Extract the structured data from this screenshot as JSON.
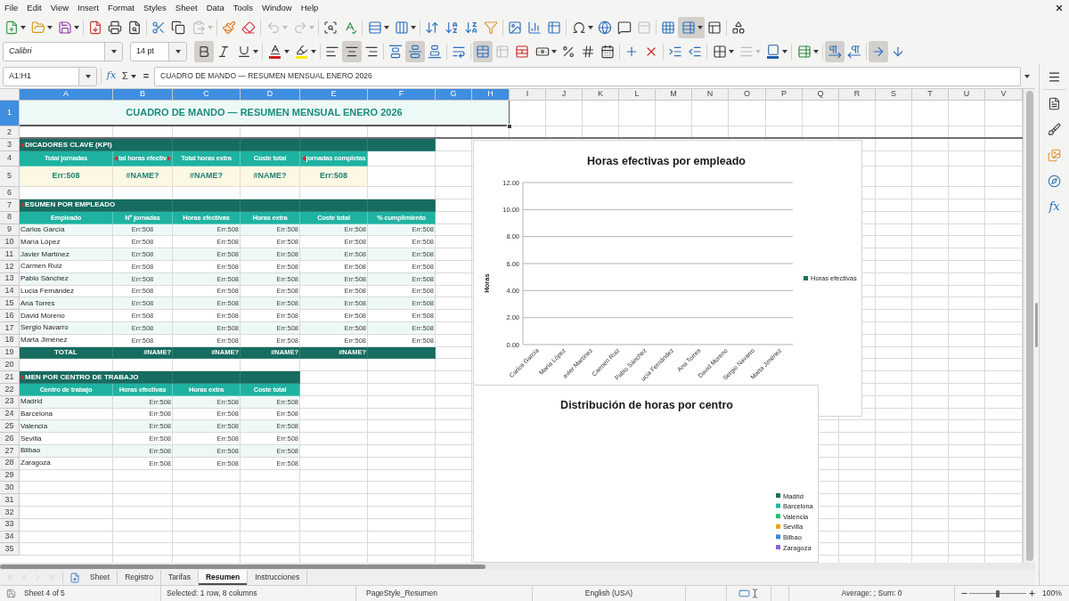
{
  "menu_bar": [
    "File",
    "Edit",
    "View",
    "Insert",
    "Format",
    "Styles",
    "Sheet",
    "Data",
    "Tools",
    "Window",
    "Help"
  ],
  "standard_toolbar": {
    "paste": {
      "disabled": true
    },
    "undo": {
      "disabled": true
    },
    "redo": {
      "disabled": true
    },
    "headers_footers": {
      "disabled": true
    },
    "freeze_rows_columns": {
      "on": true
    }
  },
  "formatting_toolbar": {
    "font_name": "Calibri",
    "font_size": "14 pt",
    "bold": {
      "on": true
    },
    "italic": {
      "on": false
    },
    "underline": {
      "on": false
    },
    "align_left": {
      "on": false
    },
    "align_center": {
      "on": true
    },
    "align_right": {
      "on": false
    },
    "align_top": {
      "on": false
    },
    "align_middle": {
      "on": true
    },
    "align_bottom": {
      "on": false
    },
    "wrap_text": {
      "on": false
    },
    "merge_and_center": {
      "on": true
    },
    "merge_cells": {
      "disabled": true
    },
    "border_style": {
      "disabled": true
    },
    "left_to_right": {
      "on": true
    },
    "right_to_left": {
      "on": false
    },
    "text_horizontal": {
      "on": true
    },
    "text_vertical": {
      "on": false
    }
  },
  "formula_bar": {
    "name_box": "A1:H1",
    "function_wizard": "fx",
    "sum": "Σ",
    "equals": "=",
    "content": "CUADRO DE MANDO — RESUMEN MENSUAL ENERO 2026"
  },
  "sheet": {
    "columns": [
      {
        "label": "A",
        "selected": true
      },
      {
        "label": "B",
        "selected": true
      },
      {
        "label": "C",
        "selected": true
      },
      {
        "label": "D",
        "selected": true
      },
      {
        "label": "E",
        "selected": true
      },
      {
        "label": "F",
        "selected": true
      },
      {
        "label": "G",
        "selected": true
      },
      {
        "label": "H",
        "selected": true
      },
      {
        "label": "I",
        "selected": false
      },
      {
        "label": "J",
        "selected": false
      },
      {
        "label": "K",
        "selected": false
      },
      {
        "label": "L",
        "selected": false
      },
      {
        "label": "M",
        "selected": false
      },
      {
        "label": "N",
        "selected": false
      },
      {
        "label": "O",
        "selected": false
      },
      {
        "label": "P",
        "selected": false
      },
      {
        "label": "Q",
        "selected": false
      },
      {
        "label": "R",
        "selected": false
      },
      {
        "label": "S",
        "selected": false
      },
      {
        "label": "T",
        "selected": false
      },
      {
        "label": "U",
        "selected": false
      },
      {
        "label": "V",
        "selected": false
      }
    ],
    "rows": [
      {
        "label": "1",
        "selected": true
      },
      {
        "label": "2",
        "selected": false
      },
      {
        "label": "3",
        "selected": false
      },
      {
        "label": "4",
        "selected": false
      },
      {
        "label": "5",
        "selected": false
      },
      {
        "label": "6",
        "selected": false
      },
      {
        "label": "7",
        "selected": false
      },
      {
        "label": "8",
        "selected": false
      },
      {
        "label": "9",
        "selected": false
      },
      {
        "label": "10",
        "selected": false
      },
      {
        "label": "11",
        "selected": false
      },
      {
        "label": "12",
        "selected": false
      },
      {
        "label": "13",
        "selected": false
      },
      {
        "label": "14",
        "selected": false
      },
      {
        "label": "15",
        "selected": false
      },
      {
        "label": "16",
        "selected": false
      },
      {
        "label": "17",
        "selected": false
      },
      {
        "label": "18",
        "selected": false
      },
      {
        "label": "19",
        "selected": false
      },
      {
        "label": "20",
        "selected": false
      },
      {
        "label": "21",
        "selected": false
      },
      {
        "label": "22",
        "selected": false
      },
      {
        "label": "23",
        "selected": false
      },
      {
        "label": "24",
        "selected": false
      },
      {
        "label": "25",
        "selected": false
      },
      {
        "label": "26",
        "selected": false
      },
      {
        "label": "27",
        "selected": false
      },
      {
        "label": "28",
        "selected": false
      },
      {
        "label": "29",
        "selected": false
      },
      {
        "label": "30",
        "selected": false
      },
      {
        "label": "31",
        "selected": false
      },
      {
        "label": "32",
        "selected": false
      },
      {
        "label": "33",
        "selected": false
      },
      {
        "label": "34",
        "selected": false
      },
      {
        "label": "35",
        "selected": false
      }
    ],
    "title": "CUADRO DE MANDO — RESUMEN MENSUAL ENERO 2026",
    "kpi": {
      "section": {
        "text": "DICADORES CLAVE (KPI)",
        "clipped_left": true,
        "clipped_right": false
      },
      "headers": [
        {
          "text": "Total jornadas",
          "clipped_left": false,
          "clipped_right": false
        },
        {
          "text": "tal horas efectiv",
          "clipped_left": true,
          "clipped_right": true
        },
        {
          "text": "Total horas extra",
          "clipped_left": false,
          "clipped_right": false
        },
        {
          "text": "Coste total",
          "clipped_left": false,
          "clipped_right": false
        },
        {
          "text": "jornadas completas",
          "clipped_left": true,
          "clipped_right": false
        }
      ],
      "values": [
        "Err:508",
        "#NAME?",
        "#NAME?",
        "#NAME?",
        "Err:508"
      ]
    },
    "employees": {
      "section": {
        "text": "ESUMEN POR EMPLEADO",
        "clipped_left": true,
        "clipped_right": false
      },
      "headers": [
        "Empleado",
        "Nº jornadas",
        "Horas efectivas",
        "Horas extra",
        "Coste total",
        "% cumplimiento"
      ],
      "rows": [
        {
          "name": "Carlos García",
          "values": [
            "Err:508",
            "Err:508",
            "Err:508",
            "Err:508",
            "Err:508"
          ]
        },
        {
          "name": "María López",
          "values": [
            "Err:508",
            "Err:508",
            "Err:508",
            "Err:508",
            "Err:508"
          ]
        },
        {
          "name": "Javier Martínez",
          "values": [
            "Err:508",
            "Err:508",
            "Err:508",
            "Err:508",
            "Err:508"
          ]
        },
        {
          "name": "Carmen Ruiz",
          "values": [
            "Err:508",
            "Err:508",
            "Err:508",
            "Err:508",
            "Err:508"
          ]
        },
        {
          "name": "Pablo Sánchez",
          "values": [
            "Err:508",
            "Err:508",
            "Err:508",
            "Err:508",
            "Err:508"
          ]
        },
        {
          "name": "Lucía Fernández",
          "values": [
            "Err:508",
            "Err:508",
            "Err:508",
            "Err:508",
            "Err:508"
          ]
        },
        {
          "name": "Ana Torres",
          "values": [
            "Err:508",
            "Err:508",
            "Err:508",
            "Err:508",
            "Err:508"
          ]
        },
        {
          "name": "David Moreno",
          "values": [
            "Err:508",
            "Err:508",
            "Err:508",
            "Err:508",
            "Err:508"
          ]
        },
        {
          "name": "Sergio Navarro",
          "values": [
            "Err:508",
            "Err:508",
            "Err:508",
            "Err:508",
            "Err:508"
          ]
        },
        {
          "name": "Marta Jiménez",
          "values": [
            "Err:508",
            "Err:508",
            "Err:508",
            "Err:508",
            "Err:508"
          ]
        }
      ],
      "total": {
        "label": "TOTAL",
        "values": [
          "#NAME?",
          "#NAME?",
          "#NAME?",
          "#NAME?"
        ]
      }
    },
    "centers": {
      "section": {
        "text": "MEN POR CENTRO DE TRABAJO",
        "clipped_left": true,
        "clipped_right": false
      },
      "headers": [
        "Centro de trabajo",
        "Horas efectivas",
        "Horas extra",
        "Coste total"
      ],
      "rows": [
        {
          "name": "Madrid",
          "values": [
            "Err:508",
            "Err:508",
            "Err:508"
          ]
        },
        {
          "name": "Barcelona",
          "values": [
            "Err:508",
            "Err:508",
            "Err:508"
          ]
        },
        {
          "name": "Valencia",
          "values": [
            "Err:508",
            "Err:508",
            "Err:508"
          ]
        },
        {
          "name": "Sevilla",
          "values": [
            "Err:508",
            "Err:508",
            "Err:508"
          ]
        },
        {
          "name": "Bilbao",
          "values": [
            "Err:508",
            "Err:508",
            "Err:508"
          ]
        },
        {
          "name": "Zaragoza",
          "values": [
            "Err:508",
            "Err:508",
            "Err:508"
          ]
        }
      ]
    }
  },
  "charts": [
    {
      "kind": "bar",
      "title": "Horas efectivas por empleado",
      "y_axis_title": "Horas",
      "y_ticks": [
        "12.00",
        "10.00",
        "8.00",
        "6.00",
        "4.00",
        "2.00",
        "0.00"
      ],
      "x_labels": [
        "Carlos García",
        "María López",
        "avier Martínez",
        "Carmen Ruiz",
        "Pablo Sánchez",
        "ucía Fernández",
        "Ana Torres",
        "David Moreno",
        "Sergio Navarro",
        "Marta Jiménez"
      ],
      "legend": [
        {
          "label": "Horas efectivas",
          "color": "#1b6f63"
        }
      ]
    },
    {
      "kind": "pie",
      "title": "Distribución de horas por centro",
      "legend": [
        {
          "label": "Madrid",
          "color": "#1b6f63"
        },
        {
          "label": "Barcelona",
          "color": "#23b3a3"
        },
        {
          "label": "Valencia",
          "color": "#2fb873"
        },
        {
          "label": "Sevilla",
          "color": "#e8a320"
        },
        {
          "label": "Bilbao",
          "color": "#3b87dc"
        },
        {
          "label": "Zaragoza",
          "color": "#8a63d9"
        }
      ]
    }
  ],
  "tab_scroll_buttons": {
    "disabled": true
  },
  "sheet_tabs": [
    {
      "label": "Sheet",
      "selected": false
    },
    {
      "label": "Registro",
      "selected": false
    },
    {
      "label": "Tarifas",
      "selected": false
    },
    {
      "label": "Resumen",
      "selected": true
    },
    {
      "label": "Instrucciones",
      "selected": false
    }
  ],
  "sidebar": {
    "functions": "fx"
  },
  "status_bar": {
    "sheet": "Sheet 4 of 5",
    "selection": "Selected: 1 row, 8 columns",
    "page_style": "PageStyle_Resumen",
    "language": "English (USA)",
    "summary": "Average: ; Sum: 0",
    "zoom_slider": {
      "level": 0.5
    },
    "zoom": "100%"
  }
}
